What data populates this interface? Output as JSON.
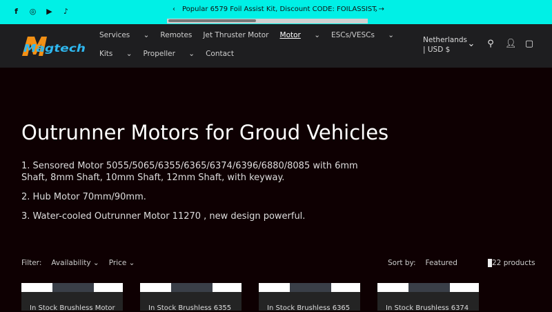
{
  "announcement": {
    "text": "Popular 6579 Foil Assist Kit, Discount CODE: FOILASSIST",
    "arrow": "→",
    "prev": "‹",
    "next": "›"
  },
  "social": [
    {
      "icon": "facebook",
      "glyph": "f"
    },
    {
      "icon": "instagram",
      "glyph": "◎"
    },
    {
      "icon": "youtube",
      "glyph": "▶"
    },
    {
      "icon": "tiktok",
      "glyph": "♪"
    }
  ],
  "brand": "Magtech",
  "nav": [
    {
      "label": "Services",
      "dropdown": true
    },
    {
      "label": "Remotes"
    },
    {
      "label": "Jet Thruster Motor"
    },
    {
      "label": "Motor",
      "dropdown": true,
      "active": true
    },
    {
      "label": "ESCs/VESCs",
      "dropdown": true
    },
    {
      "label": "Kits",
      "dropdown": true
    },
    {
      "label": "Propeller",
      "dropdown": true
    },
    {
      "label": "Contact"
    }
  ],
  "country": {
    "line1": "Netherlands",
    "line2": "| USD $"
  },
  "page": {
    "title": "Outrunner Motors for Groud Vehicles",
    "desc": [
      "1. Sensored Motor 5055/5065/6355/6365/6374/6396/6880/8085 with 6mm Shaft, 8mm Shaft, 10mm Shaft, 12mm Shaft, with keyway.",
      "2. Hub Motor 70mm/90mm.",
      "3. Water-cooled Outrunner Motor 11270 , new design powerful."
    ]
  },
  "filter": {
    "label": "Filter:",
    "availability": "Availability ⌄",
    "price": "Price ⌄"
  },
  "sort": {
    "label": "Sort by:",
    "value": "Featured"
  },
  "count": "22 products",
  "products": [
    "In Stock Brushless Motor",
    "In Stock Brushless 6355",
    "In Stock Brushless 6365",
    "In Stock Brushless 6374"
  ]
}
